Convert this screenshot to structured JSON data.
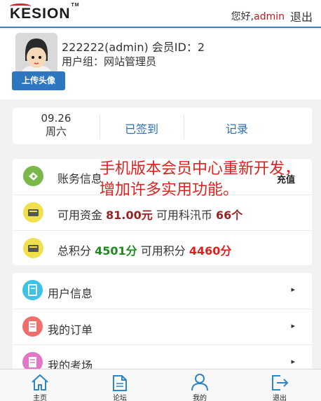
{
  "header": {
    "logo_text": "KESION",
    "greeting": "您好,",
    "username": "admin",
    "logout_label": "退出"
  },
  "profile": {
    "name_line": "222222(admin) 会员ID：2",
    "group_line": "用户组：网站管理员",
    "upload_label": "上传头像"
  },
  "checkin": {
    "date": "09.26",
    "weekday": "周六",
    "status_label": "已签到",
    "records_label": "记录"
  },
  "account": {
    "title": "账务信息",
    "recharge_label": "充值",
    "funds_prefix": "可用资金",
    "funds_value": "81.00元",
    "coins_prefix": "可用科汛币",
    "coins_value": "66个",
    "points_prefix": "总积分",
    "points_total": "4501分",
    "points_available_prefix": "可用积分",
    "points_available": "4460分"
  },
  "overlay_text": "手机版本会员中心重新开发，增加许多实用功能。",
  "menu": [
    {
      "label": "用户信息",
      "icon": "user-info-icon"
    },
    {
      "label": "我的订单",
      "icon": "orders-icon"
    },
    {
      "label": "我的考场",
      "icon": "exam-icon"
    }
  ],
  "tabbar": [
    {
      "label": "主页",
      "icon": "home-icon"
    },
    {
      "label": "论坛",
      "icon": "forum-icon"
    },
    {
      "label": "我的",
      "icon": "profile-icon"
    },
    {
      "label": "退出",
      "icon": "logout-icon"
    }
  ],
  "colors": {
    "accent": "#2c86c8",
    "link_blue": "#2c6fb1",
    "red": "#c8161d",
    "green": "#1e8a1e"
  }
}
